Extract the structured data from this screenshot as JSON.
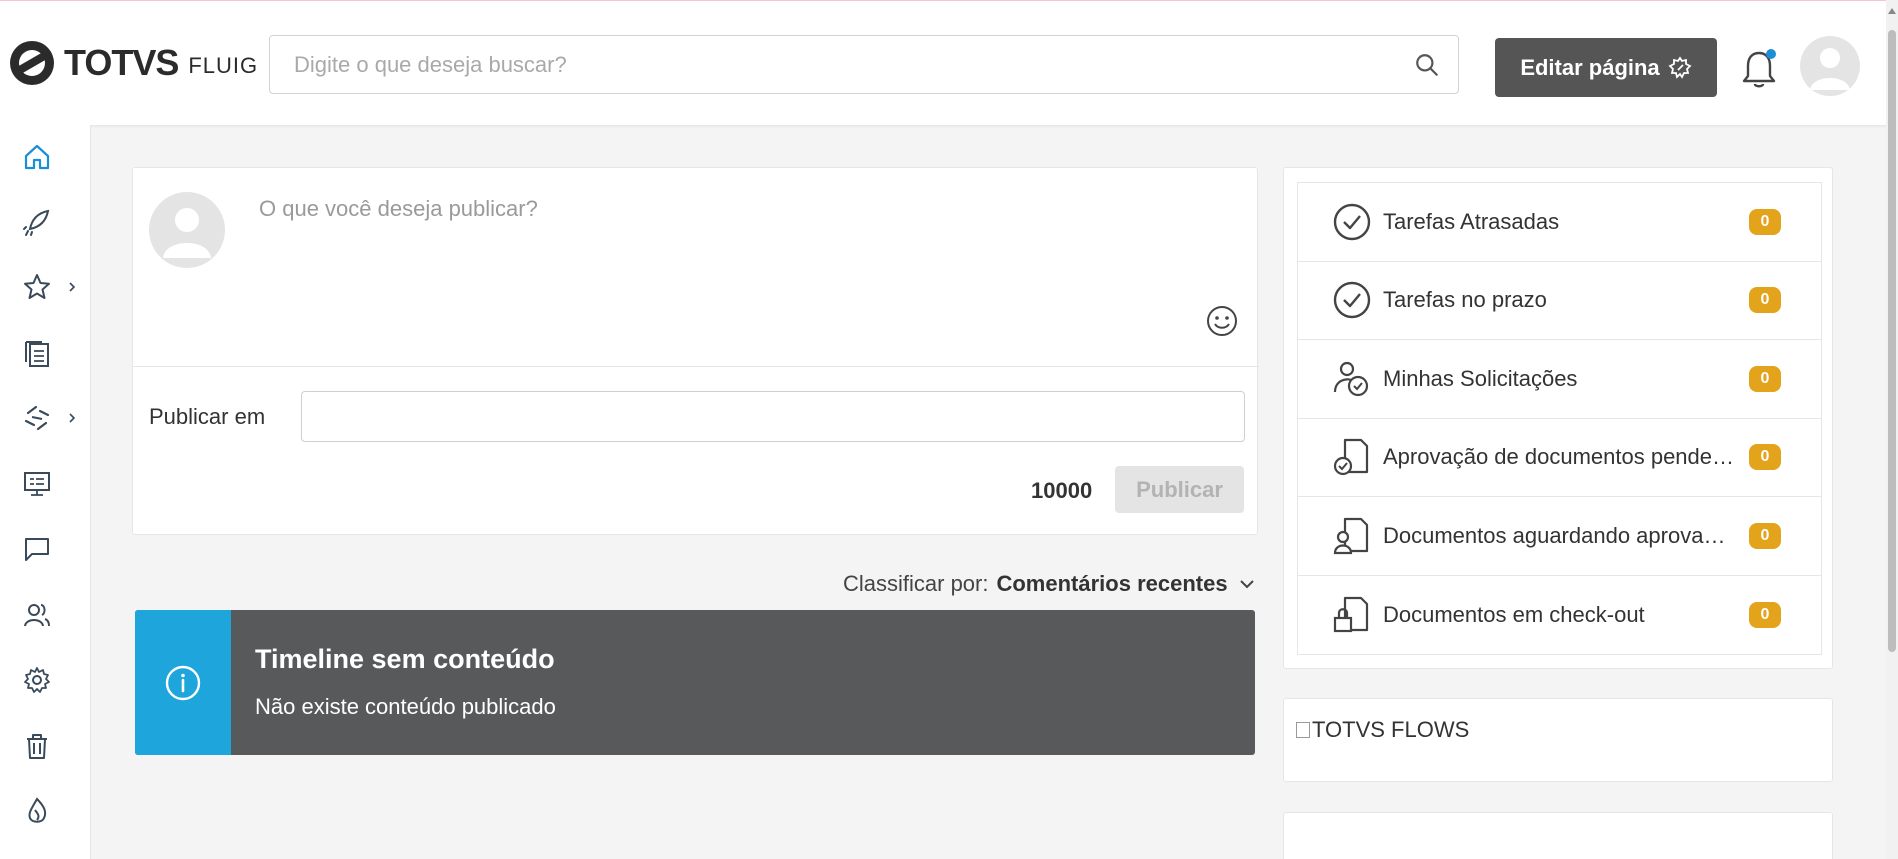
{
  "header": {
    "brand": "TOTVS",
    "brand_sub": "FLUIG",
    "search_placeholder": "Digite o que deseja buscar?",
    "edit_page_label": "Editar página"
  },
  "sidebar": {
    "items": [
      {
        "icon": "home-icon"
      },
      {
        "icon": "rocket-icon"
      },
      {
        "icon": "star-icon"
      },
      {
        "icon": "documents-icon"
      },
      {
        "icon": "workflow-icon"
      },
      {
        "icon": "monitor-icon"
      },
      {
        "icon": "chat-icon"
      },
      {
        "icon": "users-icon"
      },
      {
        "icon": "gear-icon"
      },
      {
        "icon": "trash-icon"
      },
      {
        "icon": "fluig-icon"
      }
    ]
  },
  "post": {
    "placeholder": "O que você deseja publicar?",
    "publish_in_label": "Publicar em",
    "char_count": "10000",
    "publish_button": "Publicar"
  },
  "sort": {
    "label": "Classificar por:",
    "value": "Comentários recentes"
  },
  "alert": {
    "title": "Timeline sem conteúdo",
    "message": "Não existe conteúdo publicado",
    "side_color": "#1ea6dc",
    "bg_color": "#58595b"
  },
  "tasks": [
    {
      "label": "Tarefas Atrasadas",
      "count": "0",
      "icon": "clock-check-icon"
    },
    {
      "label": "Tarefas no prazo",
      "count": "0",
      "icon": "clock-check-icon"
    },
    {
      "label": "Minhas Solicitações",
      "count": "0",
      "icon": "user-clock-icon"
    },
    {
      "label": "Aprovação de documentos pendentes",
      "count": "0",
      "icon": "document-clock-icon"
    },
    {
      "label": "Documentos aguardando aprovação",
      "count": "0",
      "icon": "document-user-icon"
    },
    {
      "label": "Documentos em check-out",
      "count": "0",
      "icon": "document-lock-icon"
    }
  ],
  "flows": {
    "alt_text": "TOTVS FLOWS"
  },
  "colors": {
    "badge": "#e3a31b",
    "edit_button": "#555555",
    "notification_dot": "#1a8fd6"
  }
}
